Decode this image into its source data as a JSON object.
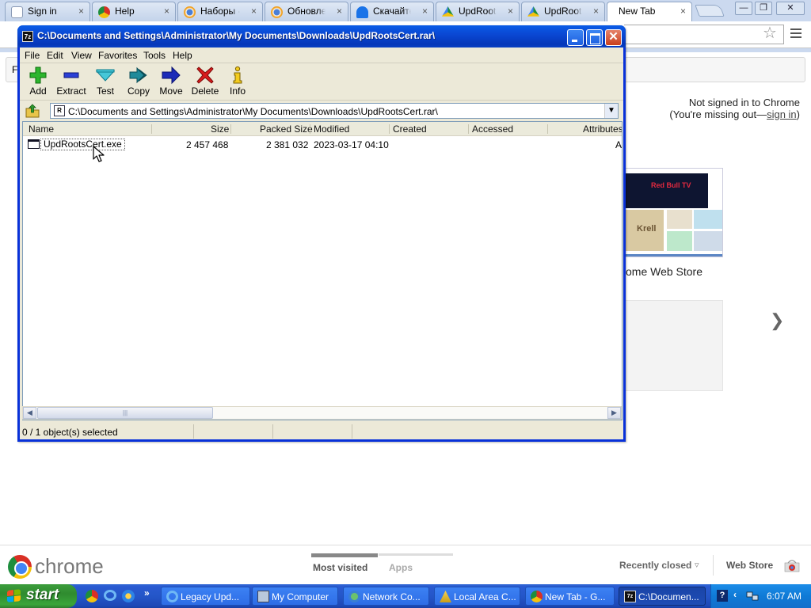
{
  "browser": {
    "tabs": [
      {
        "label": "Sign in",
        "icon": "doc-icon",
        "close": "×"
      },
      {
        "label": "Help",
        "icon": "chrome-icon",
        "close": "×"
      },
      {
        "label": "Наборы - Г",
        "icon": "chrome-icon",
        "close": "×"
      },
      {
        "label": "Обновлен",
        "icon": "chrome-icon",
        "close": "×"
      },
      {
        "label": "Скачайте",
        "icon": "cloud-icon",
        "close": "×"
      },
      {
        "label": "UpdRootsC",
        "icon": "drive-icon",
        "close": "×"
      },
      {
        "label": "UpdRootsC",
        "icon": "drive-icon",
        "close": "×"
      },
      {
        "label": "New Tab",
        "icon": "",
        "close": "×"
      }
    ],
    "window_controls": {
      "minimize": "—",
      "restore": "❐",
      "close": "✕"
    },
    "bookmark_strip_text": "F",
    "signin_notice": {
      "line1": "Not signed in to Chrome",
      "line2_prefix": "(You're missing out—",
      "link": "sign in",
      "line2_suffix": ")"
    },
    "webstore_tile": {
      "label": "ome Web Store",
      "banner_text": "Red Bull TV",
      "tile_text": "Krell"
    },
    "next_arrow": "❯",
    "footer": {
      "logo_word": "chrome",
      "most_visited": "Most visited",
      "apps": "Apps",
      "recently_closed": "Recently closed",
      "recently_closed_chevron": "▿",
      "web_store": "Web Store"
    }
  },
  "zip": {
    "title": "C:\\Documents and Settings\\Administrator\\My Documents\\Downloads\\UpdRootsCert.rar\\",
    "title_icon": "7z",
    "menu": [
      "File",
      "Edit",
      "View",
      "Favorites",
      "Tools",
      "Help"
    ],
    "toolbar": [
      {
        "label": "Add",
        "icon": "plus-icon"
      },
      {
        "label": "Extract",
        "icon": "minus-icon"
      },
      {
        "label": "Test",
        "icon": "check-icon"
      },
      {
        "label": "Copy",
        "icon": "double-arrow-icon"
      },
      {
        "label": "Move",
        "icon": "arrow-right-icon"
      },
      {
        "label": "Delete",
        "icon": "x-icon"
      },
      {
        "label": "Info",
        "icon": "info-icon"
      }
    ],
    "path": "C:\\Documents and Settings\\Administrator\\My Documents\\Downloads\\UpdRootsCert.rar\\",
    "path_dropdown": "▼",
    "columns": [
      "Name",
      "Size",
      "Packed Size",
      "Modified",
      "Created",
      "Accessed",
      "Attributes"
    ],
    "rows": [
      {
        "name": "UpdRootsCert.exe",
        "size": "2 457 468",
        "packed": "2 381 032",
        "modified": "2023-03-17 04:10",
        "created": "",
        "accessed": "",
        "attributes": "A"
      }
    ],
    "scroll_left": "◀",
    "scroll_right": "▶",
    "scroll_grip": "|||",
    "status": "0 / 1 object(s) selected"
  },
  "taskbar": {
    "start": "start",
    "quicklaunch_more": "»",
    "buttons": [
      {
        "label": "Legacy Upd...",
        "icon": "ie-icon"
      },
      {
        "label": "My Computer",
        "icon": "computer-icon"
      },
      {
        "label": "Network Co...",
        "icon": "network-icon"
      },
      {
        "label": "Local Area C...",
        "icon": "lan-icon"
      },
      {
        "label": "New Tab - G...",
        "icon": "chrome-icon"
      },
      {
        "label": "C:\\Documen...",
        "icon": "7zip-icon"
      }
    ],
    "tray_help": "?",
    "tray_chevron": "‹",
    "clock": "6:07 AM"
  },
  "colors": {
    "xp_blue": "#0a48d4",
    "start_green": "#3aa53a",
    "chrome_frame": "#cbd9ef"
  }
}
